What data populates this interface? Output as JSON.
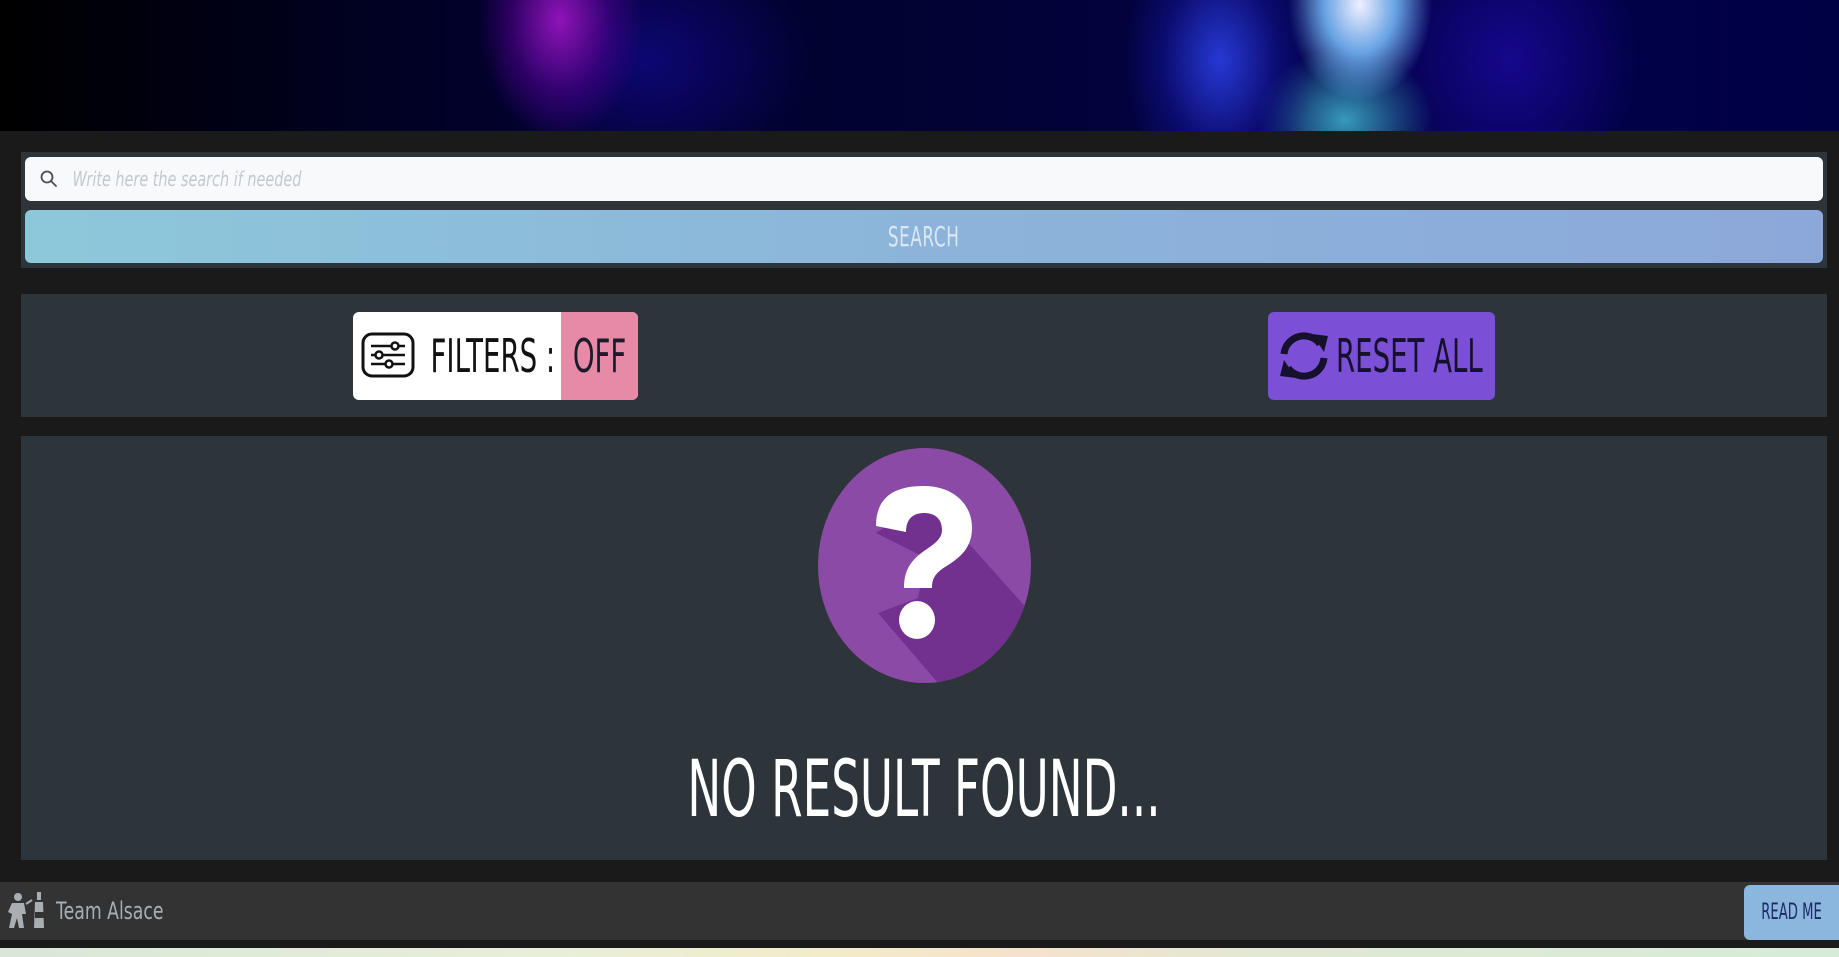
{
  "search": {
    "placeholder": "Write here the search if needed",
    "button_label": "SEARCH"
  },
  "filters": {
    "label": "FILTERS :",
    "state": "OFF",
    "icon": "sliders-icon"
  },
  "reset": {
    "label": "RESET ALL",
    "icon": "refresh-icon"
  },
  "results": {
    "empty_message": "NO RESULT FOUND...",
    "icon": "question-mark-icon"
  },
  "footer": {
    "team_name": "Team Alsace",
    "read_me_label": "READ ME"
  },
  "colors": {
    "panel": "#2d353b",
    "search_button": "#8cb4da",
    "filters_off": "#e68aa8",
    "reset_button": "#7b4fd6",
    "question_circle": "#8a4aa6"
  }
}
